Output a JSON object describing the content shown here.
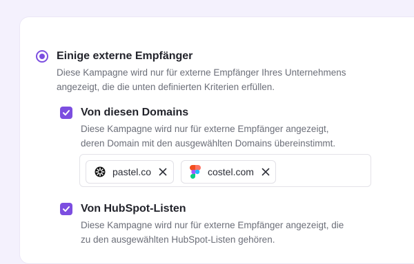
{
  "option_some": {
    "title": "Einige externe Empfänger",
    "desc_line1": "Diese Kampagne wird nur für externe Empfänger Ihres Unternehmens",
    "desc_line2": "angezeigt, die die unten definierten Kriterien erfüllen.",
    "selected": true
  },
  "domains_option": {
    "title": "Von diesen Domains",
    "desc_line1": "Diese Kampagne wird nur für externe Empfänger angezeigt,",
    "desc_line2": "deren Domain mit den ausgewählten Domains übereinstimmt.",
    "checked": true,
    "chips": [
      {
        "label": "pastel.co",
        "icon": "pastel-logo-icon"
      },
      {
        "label": "costel.com",
        "icon": "figma-logo-icon"
      }
    ]
  },
  "hubspot_option": {
    "title": "Von HubSpot-Listen",
    "desc_line1": "Diese Kampagne wird nur für externe Empfänger angezeigt, die",
    "desc_line2": "zu den ausgewählten HubSpot-Listen gehören.",
    "checked": true
  },
  "colors": {
    "accent": "#7c4ee0",
    "background": "#f4f1fd"
  }
}
